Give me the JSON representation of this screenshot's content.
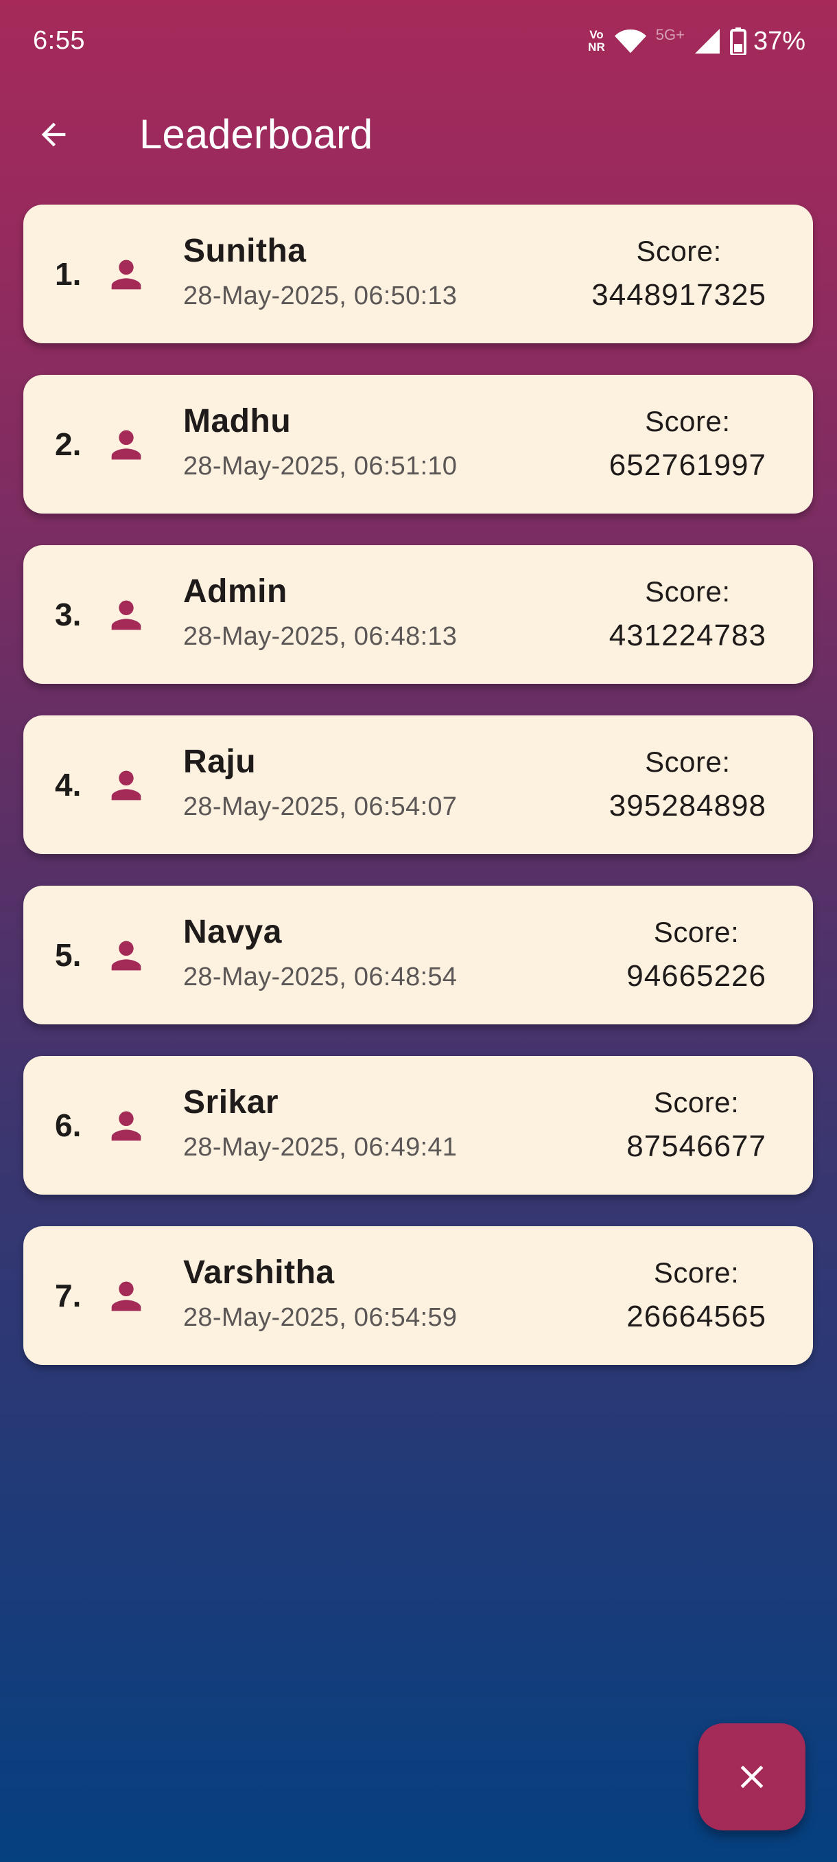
{
  "status_bar": {
    "time": "6:55",
    "volte_line1": "Vo",
    "volte_line2": "NR",
    "network": "5G+",
    "battery": "37%"
  },
  "app_bar": {
    "title": "Leaderboard",
    "back_icon": "arrow-back-icon"
  },
  "colors": {
    "accent": "#a42a58",
    "card_background": "#fdf1df",
    "gradient_top": "#a52a5a",
    "gradient_bottom": "#05407f"
  },
  "score_label": "Score:",
  "entries": [
    {
      "rank": "1.",
      "name": "Sunitha",
      "date": "28-May-2025, 06:50:13",
      "score": "3448917325"
    },
    {
      "rank": "2.",
      "name": "Madhu",
      "date": "28-May-2025, 06:51:10",
      "score": "652761997"
    },
    {
      "rank": "3.",
      "name": "Admin",
      "date": "28-May-2025, 06:48:13",
      "score": "431224783"
    },
    {
      "rank": "4.",
      "name": "Raju",
      "date": "28-May-2025, 06:54:07",
      "score": "395284898"
    },
    {
      "rank": "5.",
      "name": "Navya",
      "date": "28-May-2025, 06:48:54",
      "score": "94665226"
    },
    {
      "rank": "6.",
      "name": "Srikar",
      "date": "28-May-2025, 06:49:41",
      "score": "87546677"
    },
    {
      "rank": "7.",
      "name": "Varshitha",
      "date": "28-May-2025, 06:54:59",
      "score": "26664565"
    }
  ],
  "fab": {
    "icon": "close-icon"
  }
}
